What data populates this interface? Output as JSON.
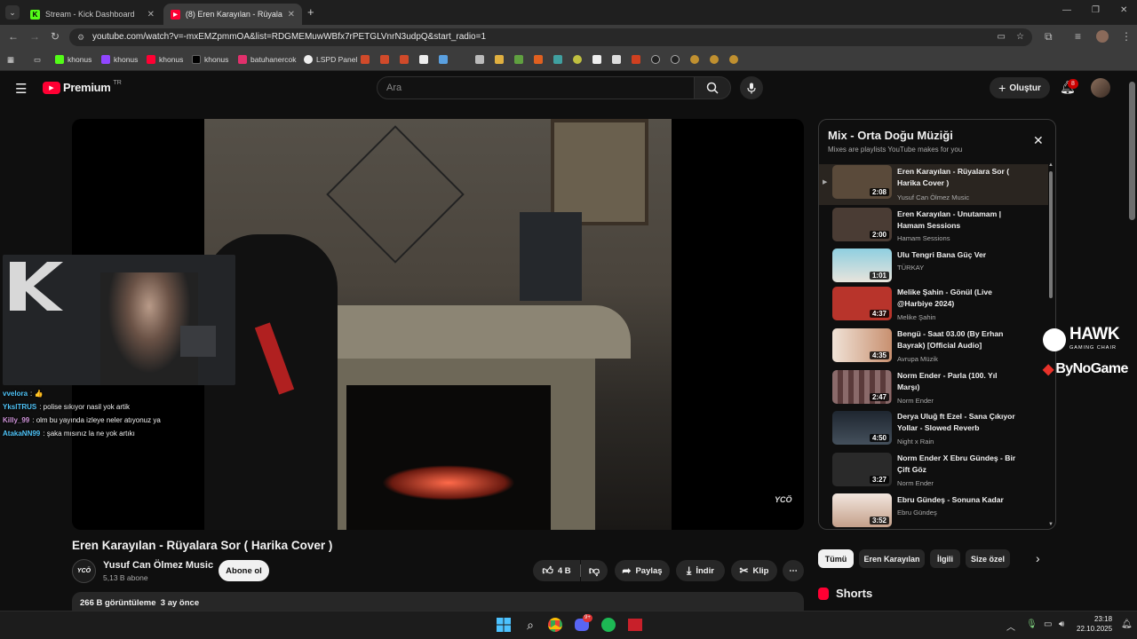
{
  "browser": {
    "tabs": [
      {
        "title": "Stream - Kick Dashboard",
        "favicon": "K",
        "color": "#53fc18"
      },
      {
        "title": "(8) Eren Karayılan - Rüyalara Sor",
        "favicon": "▶",
        "color": "#ff0033"
      }
    ],
    "new_tab": "+",
    "url": "youtube.com/watch?v=-mxEMZpmmOA&list=RDGMEMuwWBfx7rPETGLVnrN3udpQ&start_radio=1",
    "bookmarks": [
      {
        "label": "khonus",
        "color": "#53fc18"
      },
      {
        "label": "khonus",
        "color": "#9146ff"
      },
      {
        "label": "khonus",
        "color": "#ff0033"
      },
      {
        "label": "khonus",
        "color": "#000000"
      },
      {
        "label": "batuhanercok",
        "color": "#e1306c"
      },
      {
        "label": "LSPD Panel",
        "color": "#222222"
      }
    ]
  },
  "youtube": {
    "logo": "Premium",
    "region": "TR",
    "search_placeholder": "Ara",
    "create_label": "Oluştur",
    "notif_count": "8"
  },
  "video": {
    "title": "Eren Karayılan - Rüyalara Sor ( Harika Cover )",
    "channel": "Yusuf Can Ölmez Music",
    "channel_avatar_text": "YCÖ",
    "subscribers": "5,13 B abone",
    "subscribe_label": "Abone ol",
    "likes": "4 B",
    "share_label": "Paylaş",
    "download_label": "İndir",
    "clip_label": "Klip",
    "more_label": "⋯",
    "views_date": "266 B görüntüleme  3 ay önce",
    "watermark": "YCÖ"
  },
  "overlay": {
    "chat": [
      {
        "user": "vvelora",
        "color": "#4fc3f7",
        "msg": ": 👍"
      },
      {
        "user": "YkslTRUS",
        "color": "#4fc3f7",
        "msg": ": polise sıkıyor nasil yok artik"
      },
      {
        "user": "Killy_99",
        "color": "#ce93d8",
        "msg": ": olm bu yayında izleye neler atıyonuz ya"
      },
      {
        "user": "AtakaNN99",
        "color": "#4fc3f7",
        "msg": ": şaka mısınız la ne yok artıkı"
      }
    ]
  },
  "playlist": {
    "title": "Mix - Orta Doğu Müziği",
    "subtitle": "Mixes are playlists YouTube makes for you",
    "items": [
      {
        "title": "Eren Karayılan - Rüyalara Sor ( Harika Cover )",
        "channel": "Yusuf Can Ölmez Music",
        "duration": "2:08",
        "thumb": "#5a4a3a"
      },
      {
        "title": "Eren Karayılan - Unutamam | Hamam Sessions",
        "channel": "Hamam Sessions",
        "duration": "2:00",
        "thumb": "#4a3c34"
      },
      {
        "title": "Ulu Tengri Bana Güç Ver",
        "channel": "TÜRKAY",
        "duration": "1:01",
        "thumb": "#6fb6c9"
      },
      {
        "title": "Melike Şahin - Gönül (Live @Harbiye 2024)",
        "channel": "Melike Şahin",
        "duration": "4:37",
        "thumb": "#b8342b"
      },
      {
        "title": "Bengü - Saat 03.00 (By Erhan Bayrak) [Official Audio]",
        "channel": "Avrupa Müzik",
        "duration": "4:35",
        "thumb": "#d9b8a8"
      },
      {
        "title": "Norm Ender - Parla (100. Yıl Marşı)",
        "channel": "Norm Ender",
        "duration": "2:47",
        "thumb": "#7a5a5a"
      },
      {
        "title": "Derya Uluğ ft Ezel - Sana Çıkıyor Yollar - Slowed Reverb",
        "channel": "Night x Rain",
        "duration": "4:50",
        "thumb": "#2c3440"
      },
      {
        "title": "Norm Ender X Ebru Gündeş - Bir Çift Göz",
        "channel": "Norm Ender",
        "duration": "3:27",
        "thumb": "#2a2a2a"
      },
      {
        "title": "Ebru Gündeş - Sonuna Kadar",
        "channel": "Ebru Gündeş",
        "duration": "3:52",
        "thumb": "#e0cfc4"
      }
    ]
  },
  "chips": [
    "Tümü",
    "Eren Karayılan",
    "İlgili",
    "Size özel"
  ],
  "shorts_label": "Shorts",
  "sponsor": {
    "brand1": "HAWK",
    "brand1_sub": "GAMING CHAIR",
    "brand2": "ByNoGame"
  },
  "taskbar": {
    "time": "23:18",
    "date": "22.10.2025",
    "discord_badge": "9+"
  }
}
